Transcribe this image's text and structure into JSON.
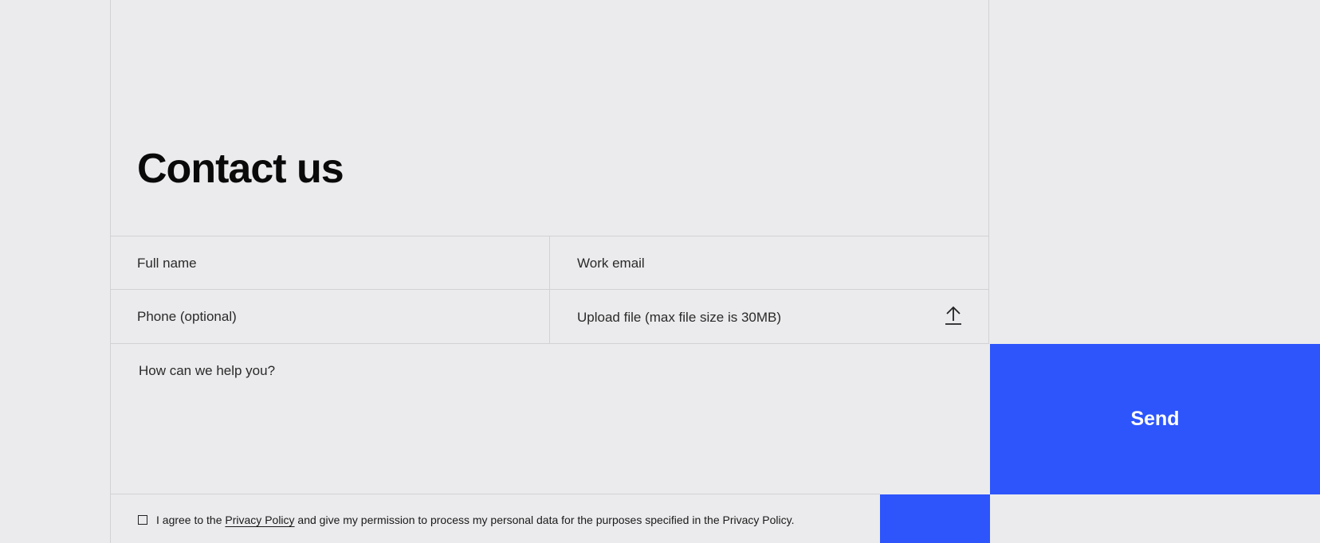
{
  "form": {
    "title": "Contact us",
    "full_name_placeholder": "Full name",
    "work_email_placeholder": "Work email",
    "phone_placeholder": "Phone (optional)",
    "upload_label": "Upload file (max file size is 30MB)",
    "message_placeholder": "How can we help you?",
    "send_label": "Send",
    "consent": {
      "prefix": "I agree to the ",
      "link_text": "Privacy Policy",
      "suffix": " and give my permission to process my personal data for the purposes specified in the Privacy Policy."
    },
    "icons": {
      "upload": "upload-arrow-icon",
      "checkbox": "checkbox-unchecked"
    }
  },
  "colors": {
    "background": "#ebebed",
    "accent": "#2d55fb",
    "border": "#d2d2d5",
    "text": "#1a1a1a"
  }
}
